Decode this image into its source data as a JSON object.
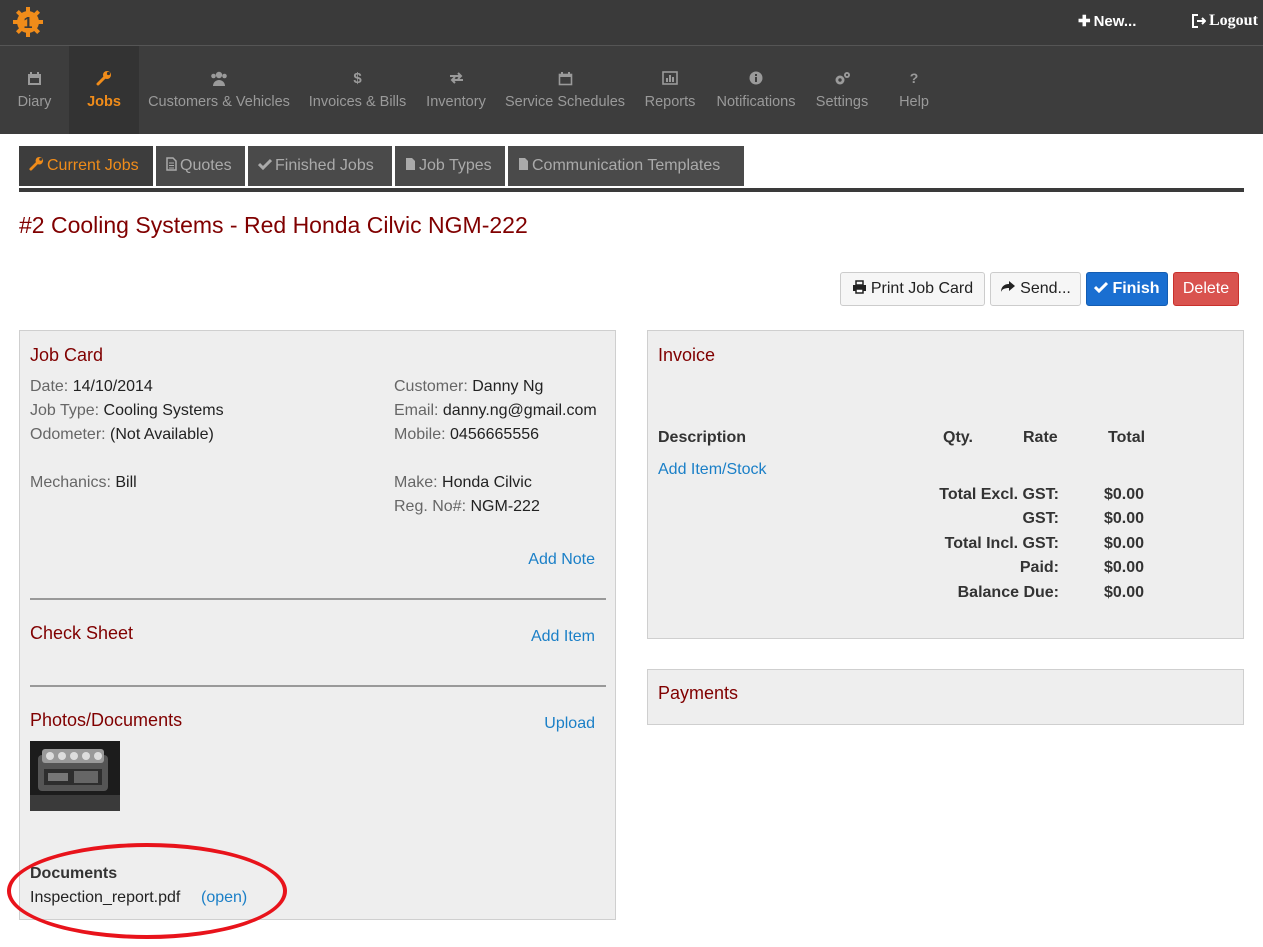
{
  "topbar": {
    "new_label": "New...",
    "logout_label": "Logout"
  },
  "nav": [
    {
      "label": "Diary",
      "icon": "calendar-icon"
    },
    {
      "label": "Jobs",
      "icon": "wrench-icon"
    },
    {
      "label": "Customers & Vehicles",
      "icon": "users-icon"
    },
    {
      "label": "Invoices & Bills",
      "icon": "dollar-icon"
    },
    {
      "label": "Inventory",
      "icon": "exchange-icon"
    },
    {
      "label": "Service Schedules",
      "icon": "calendar-icon"
    },
    {
      "label": "Reports",
      "icon": "bar-chart-icon"
    },
    {
      "label": "Notifications",
      "icon": "info-icon"
    },
    {
      "label": "Settings",
      "icon": "gears-icon"
    },
    {
      "label": "Help",
      "icon": "question-icon"
    }
  ],
  "subtabs": [
    {
      "label": "Current Jobs",
      "icon": "wrench-icon"
    },
    {
      "label": "Quotes",
      "icon": "document-icon"
    },
    {
      "label": "Finished Jobs",
      "icon": "check-icon"
    },
    {
      "label": "Job Types",
      "icon": "file-icon"
    },
    {
      "label": "Communication Templates",
      "icon": "file-icon"
    }
  ],
  "page_title": "#2 Cooling Systems - Red Honda Cilvic NGM-222",
  "actions": {
    "print": "Print Job Card",
    "send": "Send...",
    "finish": "Finish",
    "delete": "Delete"
  },
  "job_card": {
    "title": "Job Card",
    "date_label": "Date:",
    "date": "14/10/2014",
    "job_type_label": "Job Type:",
    "job_type": "Cooling Systems",
    "odometer_label": "Odometer:",
    "odometer": "(Not Available)",
    "mechanics_label": "Mechanics:",
    "mechanics": "Bill",
    "customer_label": "Customer:",
    "customer": "Danny Ng",
    "email_label": "Email:",
    "email": "danny.ng@gmail.com",
    "mobile_label": "Mobile:",
    "mobile": "0456665556",
    "make_label": "Make:",
    "make": "Honda Cilvic",
    "reg_label": "Reg. No#:",
    "reg": "NGM-222",
    "add_note": "Add Note",
    "check_sheet_title": "Check Sheet",
    "add_item": "Add Item",
    "photos_title": "Photos/Documents",
    "upload": "Upload",
    "documents_title": "Documents",
    "document_name": "Inspection_report.pdf",
    "open_link": "(open)"
  },
  "invoice": {
    "title": "Invoice",
    "columns": [
      "Description",
      "Qty.",
      "Rate",
      "Total"
    ],
    "add_item": "Add Item/Stock",
    "totals": [
      {
        "label": "Total Excl. GST:",
        "value": "$0.00"
      },
      {
        "label": "GST:",
        "value": "$0.00"
      },
      {
        "label": "Total Incl. GST:",
        "value": "$0.00"
      },
      {
        "label": "Paid:",
        "value": "$0.00"
      },
      {
        "label": "Balance Due:",
        "value": "$0.00"
      }
    ]
  },
  "payments": {
    "title": "Payments"
  },
  "colors": {
    "accent": "#f08c1a",
    "title": "#800000",
    "link": "#1a7fc7",
    "primary": "#1a6fd1",
    "danger": "#d9534f",
    "annotation": "#e8131b"
  }
}
